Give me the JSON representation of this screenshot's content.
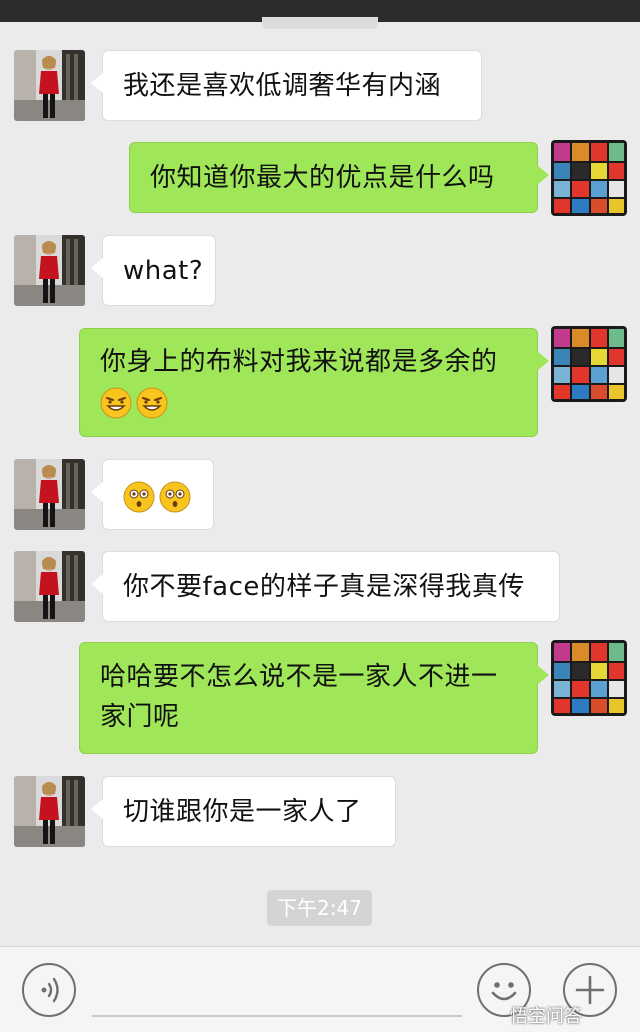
{
  "messages": [
    {
      "side": "in",
      "text": "我还是喜欢低调奢华有内涵"
    },
    {
      "side": "out",
      "text": "你知道你最大的优点是什么吗"
    },
    {
      "side": "in",
      "text": "what?"
    },
    {
      "side": "out",
      "text": "你身上的布料对我来说都是多余的",
      "emojis": [
        "grin-face-emoji",
        "grin-face-emoji"
      ]
    },
    {
      "side": "in",
      "text": "",
      "emojis": [
        "surprised-face-emoji",
        "surprised-face-emoji"
      ]
    },
    {
      "side": "in",
      "text": "你不要face的样子真是深得我真传"
    },
    {
      "side": "out",
      "text": "哈哈要不怎么说不是一家人不进一家门呢"
    },
    {
      "side": "in",
      "text": "切谁跟你是一家人了"
    }
  ],
  "timestamp": "下午2:47",
  "input_bar": {
    "voice_icon": "voice-icon",
    "emoji_icon": "smiley-icon",
    "plus_icon": "plus-icon"
  },
  "watermark": "悟空问答",
  "colors": {
    "background": "#ebebeb",
    "outgoing_bubble": "#9fe658",
    "incoming_bubble": "#ffffff",
    "timestamp_badge": "#d4d4d4"
  }
}
